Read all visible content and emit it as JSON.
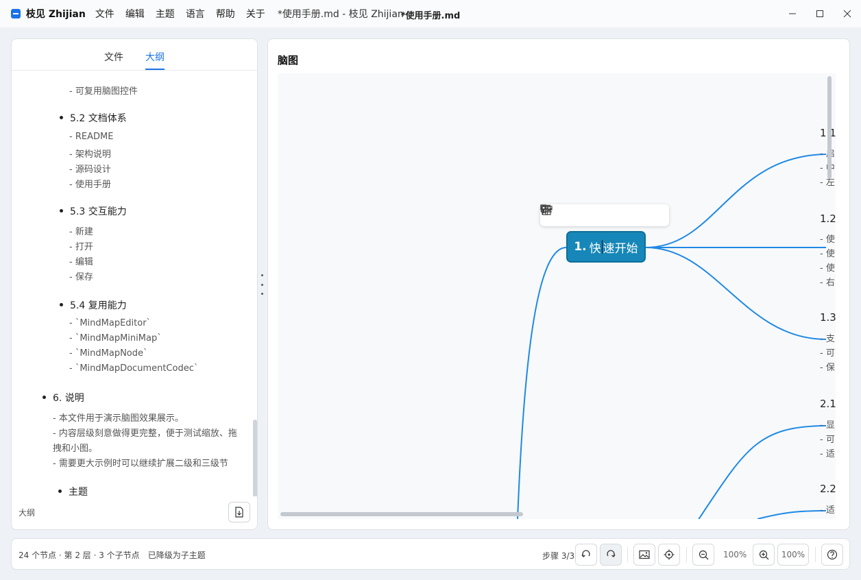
{
  "app": {
    "name": "枝见 Zhijian",
    "menu": [
      "文件",
      "编辑",
      "主题",
      "语言",
      "帮助",
      "关于"
    ],
    "doc_title": "*使用手册.md - 枝见 Zhijian",
    "center_title": "*使用手册.md",
    "accent_color": "#1a73e8"
  },
  "sidebar": {
    "tabs": [
      {
        "label": "文件",
        "active": false
      },
      {
        "label": "大纲",
        "active": true
      }
    ],
    "outline": {
      "item_reusable_control": "- 可复用脑图控件",
      "h52": "5.2 文档体系",
      "h52_items": [
        "- README",
        "- 架构说明",
        "- 源码设计",
        "- 使用手册"
      ],
      "h53": "5.3 交互能力",
      "h53_items": [
        "- 新建",
        "- 打开",
        "- 编辑",
        "- 保存"
      ],
      "h54": "5.4 复用能力",
      "h54_items": [
        "- `MindMapEditor`",
        "- `MindMapMiniMap`",
        "- `MindMapNode`",
        "- `MindMapDocumentCodec`"
      ],
      "h6": "6. 说明",
      "h6_items": [
        "- 本文件用于演示脑图效果展示。",
        "- 内容层级刻意做得更完整，便于测试缩放、拖",
        "拽和小图。",
        "- 需要更大示例时可以继续扩展二级和三级节"
      ],
      "h_theme": "主题"
    },
    "footer_label": "大纲"
  },
  "mindmap": {
    "title": "脑图",
    "root": {
      "prefix": "1.",
      "before_caret": "快",
      "after_caret": "速开始"
    },
    "children": [
      {
        "title": "1.1",
        "lines": [
          "- 启",
          "- 中",
          "- 左"
        ]
      },
      {
        "title": "1.2",
        "lines": [
          "- 使",
          "- 使",
          "- 使",
          "- 右"
        ]
      },
      {
        "title": "1.3",
        "lines": [
          "- 支",
          "- 可",
          "- 保"
        ]
      },
      {
        "title": "2.1",
        "lines": [
          "- 显",
          "- 可",
          "- 适"
        ]
      },
      {
        "title": "2.2",
        "lines": [
          "- 适"
        ]
      }
    ],
    "link_color": "#1e88e5",
    "root_color": "#1687b8"
  },
  "status": {
    "info": "24 个节点 · 第 2 层 · 3 个子节点",
    "message": "已降级为子主题",
    "step": "步骤 3/3",
    "zoom": "100%",
    "zoom_box": "100%"
  }
}
